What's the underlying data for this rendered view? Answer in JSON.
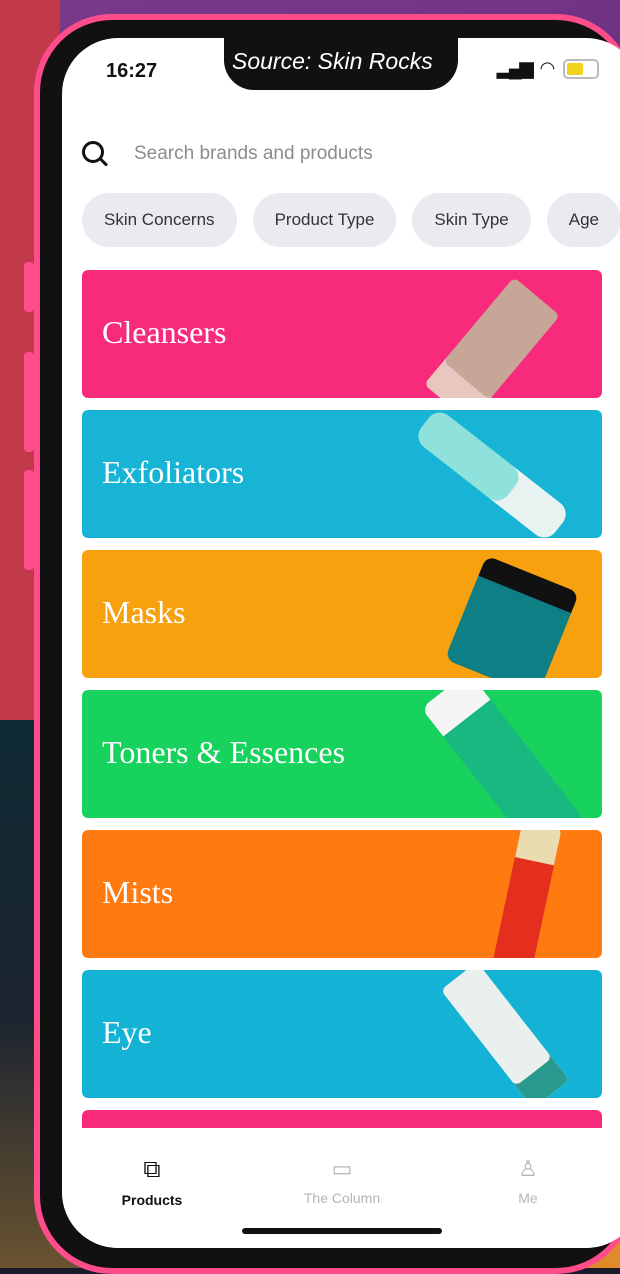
{
  "source_caption": "Source: Skin Rocks",
  "status_bar": {
    "time": "16:27"
  },
  "search": {
    "placeholder": "Search brands and products"
  },
  "filter_chips": [
    "Skin Concerns",
    "Product Type",
    "Skin Type",
    "Age"
  ],
  "categories": [
    {
      "label": "Cleansers",
      "color": "#f72a7c"
    },
    {
      "label": "Exfoliators",
      "color": "#18b4d6"
    },
    {
      "label": "Masks",
      "color": "#f7a10f"
    },
    {
      "label": "Toners & Essences",
      "color": "#17d25c"
    },
    {
      "label": "Mists",
      "color": "#ff7a10"
    },
    {
      "label": "Eye",
      "color": "#14b2d4"
    },
    {
      "label": "",
      "color": "#f72a7c"
    }
  ],
  "tab_bar": {
    "items": [
      {
        "label": "Products",
        "icon": "products-icon",
        "active": true
      },
      {
        "label": "The Column",
        "icon": "book-icon",
        "active": false
      },
      {
        "label": "Me",
        "icon": "person-icon",
        "active": false
      }
    ]
  },
  "colors": {
    "phone_frame": "#ff4d8c",
    "active_tab": "#111111",
    "inactive_tab": "#b5b5b5"
  }
}
